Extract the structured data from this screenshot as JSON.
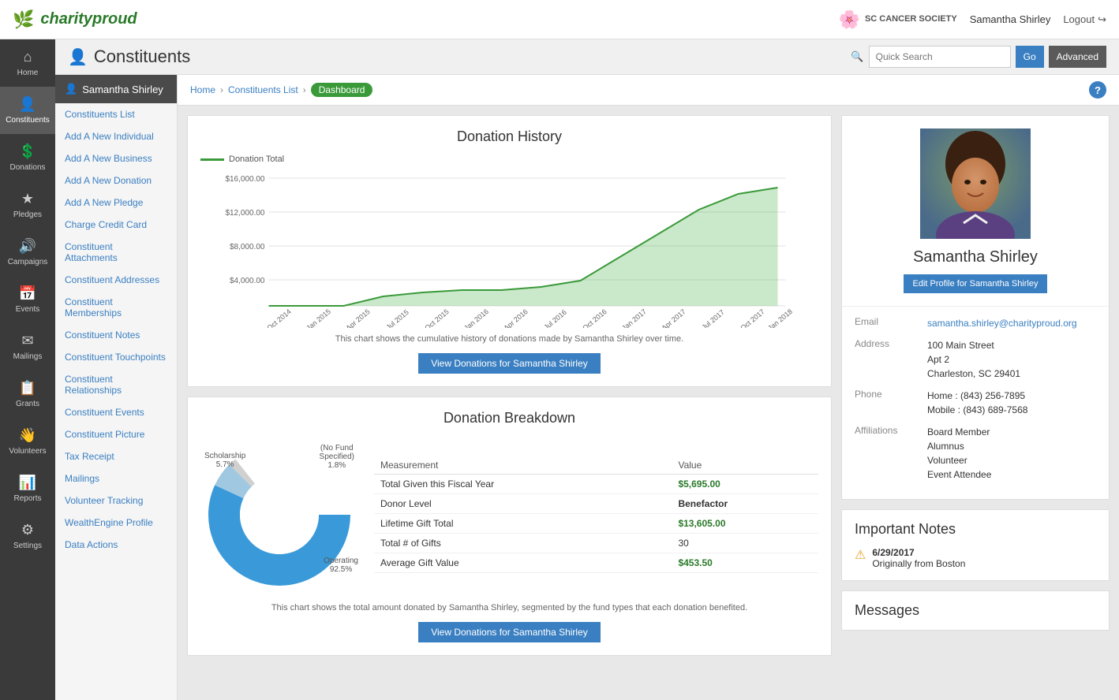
{
  "app": {
    "logo_text": "charityproud",
    "org_name": "SC CANCER SOCIETY",
    "user_name": "Samantha Shirley",
    "logout_label": "Logout"
  },
  "page": {
    "title": "Constituents",
    "search_placeholder": "Quick Search",
    "go_label": "Go",
    "advanced_label": "Advanced"
  },
  "breadcrumb": {
    "home": "Home",
    "list": "Constituents List",
    "current": "Dashboard"
  },
  "sidebar_icons": [
    {
      "id": "home",
      "icon": "⌂",
      "label": "Home"
    },
    {
      "id": "constituents",
      "icon": "👤",
      "label": "Constituents"
    },
    {
      "id": "donations",
      "icon": "💲",
      "label": "Donations"
    },
    {
      "id": "pledges",
      "icon": "★",
      "label": "Pledges"
    },
    {
      "id": "campaigns",
      "icon": "🔊",
      "label": "Campaigns"
    },
    {
      "id": "events",
      "icon": "📅",
      "label": "Events"
    },
    {
      "id": "mailings",
      "icon": "✉",
      "label": "Mailings"
    },
    {
      "id": "grants",
      "icon": "📋",
      "label": "Grants"
    },
    {
      "id": "volunteers",
      "icon": "👋",
      "label": "Volunteers"
    },
    {
      "id": "reports",
      "icon": "📊",
      "label": "Reports"
    },
    {
      "id": "settings",
      "icon": "⚙",
      "label": "Settings"
    }
  ],
  "sub_sidebar": {
    "user_name": "Samantha Shirley",
    "links": [
      "Constituents List",
      "Add A New Individual",
      "Add A New Business",
      "Add A New Donation",
      "Add A New Pledge",
      "Charge Credit Card",
      "Constituent Attachments",
      "Constituent Addresses",
      "Constituent Memberships",
      "Constituent Notes",
      "Constituent Touchpoints",
      "Constituent Relationships",
      "Constituent Events",
      "Constituent Picture",
      "Tax Receipt",
      "Mailings",
      "Volunteer Tracking",
      "WealthEngine Profile",
      "Data Actions"
    ]
  },
  "donation_history": {
    "title": "Donation History",
    "legend": "Donation Total",
    "subtitle": "This chart shows the cumulative history of donations made by Samantha Shirley over time.",
    "view_btn": "View Donations for Samantha Shirley",
    "y_labels": [
      "$16,000.00",
      "$12,000.00",
      "$8,000.00",
      "$4,000.00"
    ],
    "x_labels": [
      "Oct 2014",
      "Jan 2015",
      "Apr 2015",
      "Jul 2015",
      "Oct 2015",
      "Jan 2016",
      "Apr 2016",
      "Jul 2016",
      "Oct 2016",
      "Jan 2017",
      "Apr 2017",
      "Jul 2017",
      "Oct 2017",
      "Jan 2018"
    ]
  },
  "donation_breakdown": {
    "title": "Donation Breakdown",
    "subtitle": "This chart shows the total amount donated by Samantha Shirley, segmented by the fund types that each donation benefited.",
    "view_btn": "View Donations for Samantha Shirley",
    "segments": [
      {
        "label": "Scholarship",
        "pct": "5.7%",
        "color": "#a0c8e0",
        "sweep": 20
      },
      {
        "label": "(No Fund Specified)",
        "pct": "1.8%",
        "color": "#d0d0d0",
        "sweep": 6
      },
      {
        "label": "Operating",
        "pct": "92.5%",
        "color": "#3a9ad9",
        "sweep": 334
      }
    ],
    "table": {
      "headers": [
        "Measurement",
        "Value"
      ],
      "rows": [
        {
          "label": "Total Given this Fiscal Year",
          "value": "$5,695.00",
          "style": "green"
        },
        {
          "label": "Donor Level",
          "value": "Benefactor",
          "style": "bold"
        },
        {
          "label": "Lifetime Gift Total",
          "value": "$13,605.00",
          "style": "green"
        },
        {
          "label": "Total # of Gifts",
          "value": "30",
          "style": "normal"
        },
        {
          "label": "Average Gift Value",
          "value": "$453.50",
          "style": "green"
        }
      ]
    }
  },
  "profile": {
    "name": "Samantha Shirley",
    "edit_btn": "Edit Profile for Samantha Shirley",
    "email_label": "Email",
    "email_value": "samantha.shirley@charityproud.org",
    "address_label": "Address",
    "address_line1": "100 Main Street",
    "address_line2": "Apt 2",
    "address_line3": "Charleston, SC 29401",
    "phone_label": "Phone",
    "phone_home": "Home : (843) 256-7895",
    "phone_mobile": "Mobile : (843) 689-7568",
    "affiliations_label": "Affiliations",
    "affiliations": [
      "Board Member",
      "Alumnus",
      "Volunteer",
      "Event Attendee"
    ]
  },
  "important_notes": {
    "title": "Important Notes",
    "note_date": "6/29/2017",
    "note_text": "Originally from Boston"
  },
  "messages": {
    "title": "Messages"
  }
}
